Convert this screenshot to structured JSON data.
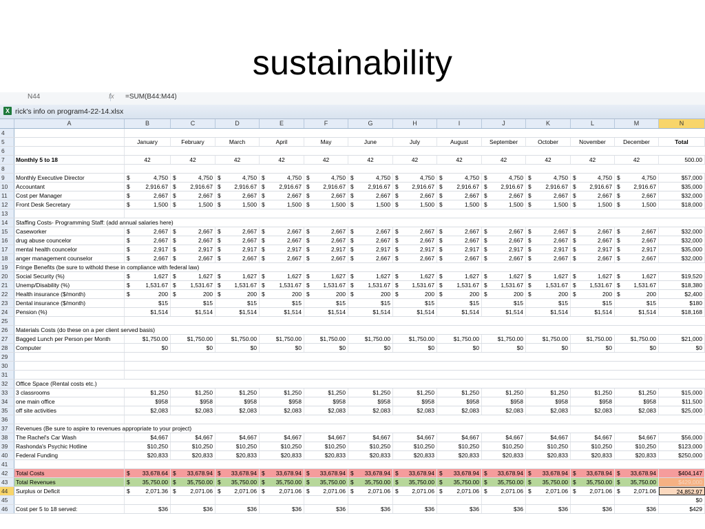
{
  "slide_title": "sustainability",
  "excel": {
    "name_box": "N44",
    "fx_label": "fx",
    "formula": "=SUM(B44:M44)",
    "window_title": "rick's info on program4-22-14.xlsx",
    "col_headers": [
      "A",
      "B",
      "C",
      "D",
      "E",
      "F",
      "G",
      "H",
      "I",
      "J",
      "K",
      "L",
      "M",
      "N"
    ],
    "selected_col": "N",
    "months": [
      "January",
      "February",
      "March",
      "April",
      "May",
      "June",
      "July",
      "August",
      "September",
      "October",
      "November",
      "December"
    ],
    "total_label": "Total",
    "rows": [
      {
        "n": "4",
        "type": "blank"
      },
      {
        "n": "5",
        "type": "header"
      },
      {
        "n": "6",
        "type": "blank"
      },
      {
        "n": "7",
        "type": "plain",
        "label": "Monthly 5 to 18",
        "bold": true,
        "cur": "",
        "vals": [
          "42",
          "42",
          "42",
          "42",
          "42",
          "42",
          "42",
          "42",
          "42",
          "42",
          "42",
          "42"
        ],
        "total": "500.00",
        "centered": true
      },
      {
        "n": "8",
        "type": "blank"
      },
      {
        "n": "9",
        "type": "data",
        "label": "Monthly Executive Director",
        "cur": "$",
        "vals": [
          "4,750",
          "4,750",
          "4,750",
          "4,750",
          "4,750",
          "4,750",
          "4,750",
          "4,750",
          "4,750",
          "4,750",
          "4,750",
          "4,750"
        ],
        "total": "$57,000"
      },
      {
        "n": "10",
        "type": "data",
        "label": "Accountant",
        "cur": "$",
        "vals": [
          "2,916.67",
          "2,916.67",
          "2,916.67",
          "2,916.67",
          "2,916.67",
          "2,916.67",
          "2,916.67",
          "2,916.67",
          "2,916.67",
          "2,916.67",
          "2,916.67",
          "2,916.67"
        ],
        "total": "$35,000"
      },
      {
        "n": "11",
        "type": "data",
        "label": "Cost per Manager",
        "cur": "$",
        "vals": [
          "2,667",
          "2,667",
          "2,667",
          "2,667",
          "2,667",
          "2,667",
          "2,667",
          "2,667",
          "2,667",
          "2,667",
          "2,667",
          "2,667"
        ],
        "total": "$32,000"
      },
      {
        "n": "12",
        "type": "data",
        "label": "Front Desk Secretary",
        "cur": "$",
        "vals": [
          "1,500",
          "1,500",
          "1,500",
          "1,500",
          "1,500",
          "1,500",
          "1,500",
          "1,500",
          "1,500",
          "1,500",
          "1,500",
          "1,500"
        ],
        "total": "$18,000"
      },
      {
        "n": "13",
        "type": "blank"
      },
      {
        "n": "14",
        "type": "label",
        "label": "Staffing Costs- Programming Staff: (add annual salaries here)"
      },
      {
        "n": "15",
        "type": "data",
        "label": "Caseworker",
        "cur": "$",
        "vals": [
          "2,667",
          "2,667",
          "2,667",
          "2,667",
          "2,667",
          "2,667",
          "2,667",
          "2,667",
          "2,667",
          "2,667",
          "2,667",
          "2,667"
        ],
        "total": "$32,000"
      },
      {
        "n": "16",
        "type": "data",
        "label": "drug abuse councelor",
        "cur": "$",
        "vals": [
          "2,667",
          "2,667",
          "2,667",
          "2,667",
          "2,667",
          "2,667",
          "2,667",
          "2,667",
          "2,667",
          "2,667",
          "2,667",
          "2,667"
        ],
        "total": "$32,000"
      },
      {
        "n": "17",
        "type": "data",
        "label": "mental health councelor",
        "cur": "$",
        "vals": [
          "2,917",
          "2,917",
          "2,917",
          "2,917",
          "2,917",
          "2,917",
          "2,917",
          "2,917",
          "2,917",
          "2,917",
          "2,917",
          "2,917"
        ],
        "total": "$35,000"
      },
      {
        "n": "18",
        "type": "data",
        "label": "anger management counselor",
        "cur": "$",
        "vals": [
          "2,667",
          "2,667",
          "2,667",
          "2,667",
          "2,667",
          "2,667",
          "2,667",
          "2,667",
          "2,667",
          "2,667",
          "2,667",
          "2,667"
        ],
        "total": "$32,000"
      },
      {
        "n": "19",
        "type": "label",
        "label": "Fringe Benefits (be sure to withold these in compliance with federal law)"
      },
      {
        "n": "20",
        "type": "data",
        "label": "  Social Security (%)",
        "cur": "$",
        "vals": [
          "1,627",
          "1,627",
          "1,627",
          "1,627",
          "1,627",
          "1,627",
          "1,627",
          "1,627",
          "1,627",
          "1,627",
          "1,627",
          "1,627"
        ],
        "total": "$19,520"
      },
      {
        "n": "21",
        "type": "data",
        "label": "  Unemp/Disability (%)",
        "cur": "$",
        "vals": [
          "1,531.67",
          "1,531.67",
          "1,531.67",
          "1,531.67",
          "1,531.67",
          "1,531.67",
          "1,531.67",
          "1,531.67",
          "1,531.67",
          "1,531.67",
          "1,531.67",
          "1,531.67"
        ],
        "total": "$18,380"
      },
      {
        "n": "22",
        "type": "data",
        "label": "  Health insurance ($/month)",
        "cur": "$",
        "vals": [
          "200",
          "200",
          "200",
          "200",
          "200",
          "200",
          "200",
          "200",
          "200",
          "200",
          "200",
          "200"
        ],
        "total": "$2,400"
      },
      {
        "n": "23",
        "type": "data",
        "label": "  Dental insurance ($/month)",
        "cur": "",
        "vals": [
          "$15",
          "$15",
          "$15",
          "$15",
          "$15",
          "$15",
          "$15",
          "$15",
          "$15",
          "$15",
          "$15",
          "$15"
        ],
        "total": "$180"
      },
      {
        "n": "24",
        "type": "data",
        "label": "  Pension (%)",
        "cur": "",
        "vals": [
          "$1,514",
          "$1,514",
          "$1,514",
          "$1,514",
          "$1,514",
          "$1,514",
          "$1,514",
          "$1,514",
          "$1,514",
          "$1,514",
          "$1,514",
          "$1,514"
        ],
        "total": "$18,168"
      },
      {
        "n": "25",
        "type": "blank"
      },
      {
        "n": "26",
        "type": "label",
        "label": "Materials Costs (do these on a per client served basis)"
      },
      {
        "n": "27",
        "type": "data",
        "label": "Bagged Lunch per Person per Month",
        "cur": "",
        "vals": [
          "$1,750.00",
          "$1,750.00",
          "$1,750.00",
          "$1,750.00",
          "$1,750.00",
          "$1,750.00",
          "$1,750.00",
          "$1,750.00",
          "$1,750.00",
          "$1,750.00",
          "$1,750.00",
          "$1,750.00"
        ],
        "total": "$21,000"
      },
      {
        "n": "28",
        "type": "data",
        "label": "Computer",
        "cur": "",
        "vals": [
          "$0",
          "$0",
          "$0",
          "$0",
          "$0",
          "$0",
          "$0",
          "$0",
          "$0",
          "$0",
          "$0",
          "$0"
        ],
        "total": "$0"
      },
      {
        "n": "29",
        "type": "blank"
      },
      {
        "n": "30",
        "type": "blank"
      },
      {
        "n": "31",
        "type": "blank"
      },
      {
        "n": "32",
        "type": "label",
        "label": "Office Space (Rental costs etc.)"
      },
      {
        "n": "33",
        "type": "data",
        "label": "3 classrooms",
        "cur": "",
        "vals": [
          "$1,250",
          "$1,250",
          "$1,250",
          "$1,250",
          "$1,250",
          "$1,250",
          "$1,250",
          "$1,250",
          "$1,250",
          "$1,250",
          "$1,250",
          "$1,250"
        ],
        "total": "$15,000"
      },
      {
        "n": "34",
        "type": "data",
        "label": "one main office",
        "cur": "",
        "vals": [
          "$958",
          "$958",
          "$958",
          "$958",
          "$958",
          "$958",
          "$958",
          "$958",
          "$958",
          "$958",
          "$958",
          "$958"
        ],
        "total": "$11,500"
      },
      {
        "n": "35",
        "type": "data",
        "label": "off site activities",
        "cur": "",
        "vals": [
          "$2,083",
          "$2,083",
          "$2,083",
          "$2,083",
          "$2,083",
          "$2,083",
          "$2,083",
          "$2,083",
          "$2,083",
          "$2,083",
          "$2,083",
          "$2,083"
        ],
        "total": "$25,000"
      },
      {
        "n": "36",
        "type": "blank"
      },
      {
        "n": "37",
        "type": "label",
        "label": "Revenues (Be sure to aspire to revenues appropriate to your project)"
      },
      {
        "n": "38",
        "type": "data",
        "label": "The Rachel's Car Wash",
        "cur": "",
        "vals": [
          "$4,667",
          "$4,667",
          "$4,667",
          "$4,667",
          "$4,667",
          "$4,667",
          "$4,667",
          "$4,667",
          "$4,667",
          "$4,667",
          "$4,667",
          "$4,667"
        ],
        "total": "$56,000"
      },
      {
        "n": "39",
        "type": "data",
        "label": "Rashonda's Psychic Hotline",
        "cur": "",
        "vals": [
          "$10,250",
          "$10,250",
          "$10,250",
          "$10,250",
          "$10,250",
          "$10,250",
          "$10,250",
          "$10,250",
          "$10,250",
          "$10,250",
          "$10,250",
          "$10,250"
        ],
        "total": "$123,000"
      },
      {
        "n": "40",
        "type": "data",
        "label": "Federal Funding",
        "cur": "",
        "vals": [
          "$20,833",
          "$20,833",
          "$20,833",
          "$20,833",
          "$20,833",
          "$20,833",
          "$20,833",
          "$20,833",
          "$20,833",
          "$20,833",
          "$20,833",
          "$20,833"
        ],
        "total": "$250,000"
      },
      {
        "n": "41",
        "type": "blank"
      },
      {
        "n": "42",
        "type": "data",
        "style": "red",
        "label": "Total Costs",
        "cur": "$",
        "vals": [
          "33,678.64",
          "33,678.94",
          "33,678.94",
          "33,678.94",
          "33,678.94",
          "33,678.94",
          "33,678.94",
          "33,678.94",
          "33,678.94",
          "33,678.94",
          "33,678.94",
          "33,678.94"
        ],
        "total": "$404,147"
      },
      {
        "n": "43",
        "type": "data",
        "style": "green",
        "label": "Total Revenues",
        "cur": "$",
        "vals": [
          "35,750.00",
          "35,750.00",
          "35,750.00",
          "35,750.00",
          "35,750.00",
          "35,750.00",
          "35,750.00",
          "35,750.00",
          "35,750.00",
          "35,750.00",
          "35,750.00",
          "35,750.00"
        ],
        "total": "$429,000"
      },
      {
        "n": "44",
        "type": "data",
        "style": "sel",
        "label": "Surplus or Deficit",
        "cur": "$",
        "vals": [
          "2,071.36",
          "2,071.06",
          "2,071.06",
          "2,071.06",
          "2,071.06",
          "2,071.06",
          "2,071.06",
          "2,071.06",
          "2,071.06",
          "2,071.06",
          "2,071.06",
          "2,071.06"
        ],
        "total": "24,852.97"
      },
      {
        "n": "45",
        "type": "data",
        "label": "",
        "cur": "",
        "vals": [
          "",
          "",
          "",
          "",
          "",
          "",
          "",
          "",
          "",
          "",
          "",
          "",
          ""
        ],
        "total": "$0"
      },
      {
        "n": "46",
        "type": "data",
        "label": "Cost per 5 to 18 served:",
        "cur": "",
        "vals": [
          "$36",
          "$36",
          "$36",
          "$36",
          "$36",
          "$36",
          "$36",
          "$36",
          "$36",
          "$36",
          "$36",
          "$36"
        ],
        "total": "$429"
      }
    ]
  }
}
